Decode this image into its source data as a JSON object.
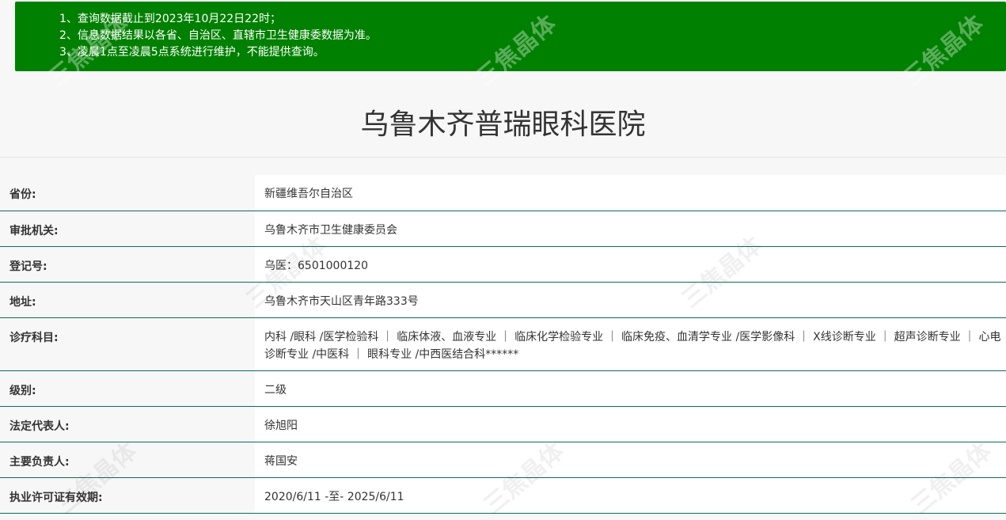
{
  "notice": {
    "lines": [
      "1、查询数据截止到2023年10月22日22时；",
      "2、信息数据结果以各省、自治区、直辖市卫生健康委数据为准。",
      "3、凌晨1点至凌晨5点系统进行维护，不能提供查询。"
    ]
  },
  "hospital": {
    "name": "乌鲁木齐普瑞眼科医院"
  },
  "fields": [
    {
      "label": "省份:",
      "value": "新疆维吾尔自治区"
    },
    {
      "label": "审批机关:",
      "value": "乌鲁木齐市卫生健康委员会"
    },
    {
      "label": "登记号:",
      "value": "乌医：6501000120"
    },
    {
      "label": "地址:",
      "value": "乌鲁木齐市天山区青年路333号"
    },
    {
      "label": "诊疗科目:",
      "value": "内科 /眼科 /医学检验科 ｜ 临床体液、血液专业 ｜ 临床化学检验专业 ｜ 临床免疫、血清学专业 /医学影像科 ｜ X线诊断专业 ｜ 超声诊断专业 ｜ 心电诊断专业 /中医科 ｜ 眼科专业 /中西医结合科******"
    },
    {
      "label": "级别:",
      "value": "二级"
    },
    {
      "label": "法定代表人:",
      "value": "徐旭阳"
    },
    {
      "label": "主要负责人:",
      "value": "蒋国安"
    },
    {
      "label": "执业许可证有效期:",
      "value": "2020/6/11 -至- 2025/6/11"
    }
  ],
  "watermark": {
    "text": "三焦晶体"
  }
}
